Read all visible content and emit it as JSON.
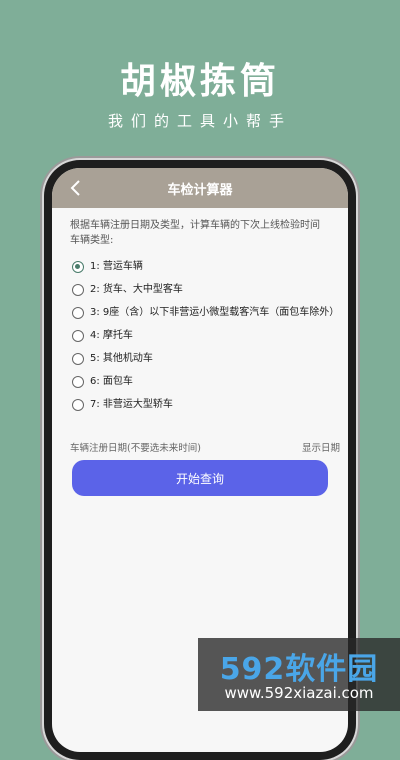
{
  "promo": {
    "title": "胡椒拣筒",
    "subtitle": "我们的工具小帮手"
  },
  "topbar": {
    "back_icon": "chevron-left-icon",
    "title": "车检计算器"
  },
  "content": {
    "description": "根据车辆注册日期及类型，计算车辆的下次上线检验时间",
    "vehicle_type_label": "车辆类型:",
    "options": [
      {
        "label": "1: 营运车辆",
        "selected": true
      },
      {
        "label": "2: 货车、大中型客车",
        "selected": false
      },
      {
        "label": "3: 9座（含）以下非营运小微型载客汽车（面包车除外）",
        "selected": false
      },
      {
        "label": "4: 摩托车",
        "selected": false
      },
      {
        "label": "5: 其他机动车",
        "selected": false
      },
      {
        "label": "6: 面包车",
        "selected": false
      },
      {
        "label": "7: 非营运大型轿车",
        "selected": false
      }
    ],
    "date_label": "车辆注册日期(不要选未来时间)",
    "date_value": "显示日期",
    "query_button": "开始查询"
  },
  "watermark": {
    "logo": "592软件园",
    "url": "www.592xiazai.com"
  },
  "colors": {
    "background": "#7fae98",
    "topbar": "#a9a196",
    "button": "#5b63e8",
    "radio_selected": "#4a7c6b"
  }
}
